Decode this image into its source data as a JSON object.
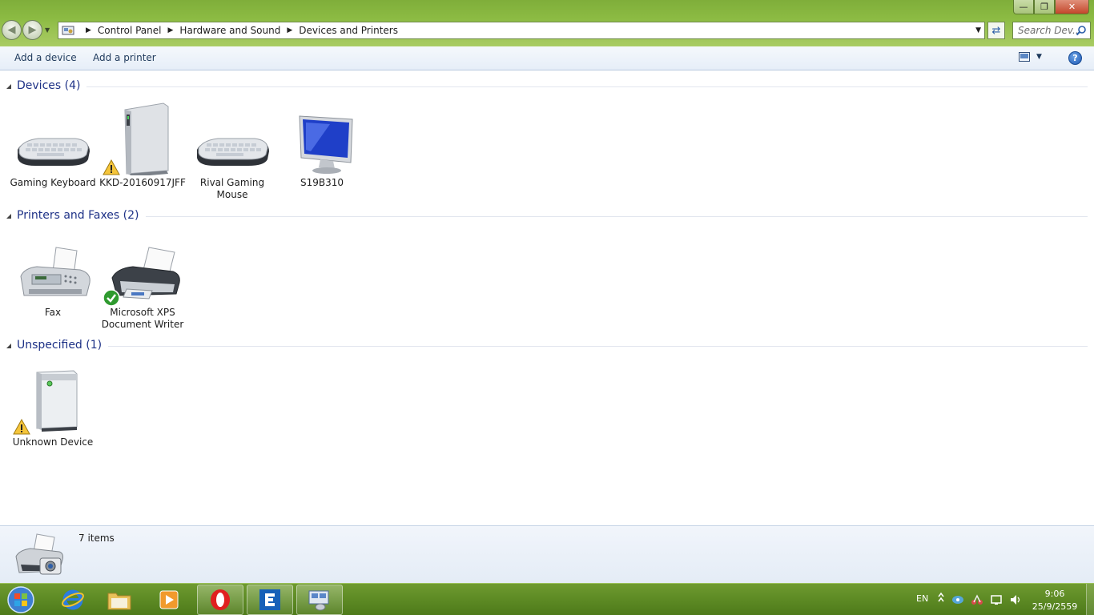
{
  "window": {
    "address": {
      "breadcrumbs": [
        "Control Panel",
        "Hardware and Sound",
        "Devices and Printers"
      ]
    },
    "search": {
      "placeholder": "Search Dev..."
    }
  },
  "commands": {
    "add_device": "Add a device",
    "add_printer": "Add a printer"
  },
  "groups": [
    {
      "title": "Devices (4)",
      "items": [
        {
          "label": "Gaming Keyboard",
          "icon": "keyboard-icon",
          "warning": false
        },
        {
          "label": "KKD-20160917JFF",
          "icon": "computer-tower-icon",
          "warning": true
        },
        {
          "label": "Rival Gaming Mouse",
          "icon": "keyboard-icon",
          "warning": false
        },
        {
          "label": "S19B310",
          "icon": "monitor-icon",
          "warning": false
        }
      ]
    },
    {
      "title": "Printers and Faxes (2)",
      "items": [
        {
          "label": "Fax",
          "icon": "fax-icon",
          "default": false
        },
        {
          "label": "Microsoft XPS Document Writer",
          "icon": "printer-icon",
          "default": true
        }
      ]
    },
    {
      "title": "Unspecified (1)",
      "items": [
        {
          "label": "Unknown Device",
          "icon": "unknown-device-icon",
          "warning": true
        }
      ]
    }
  ],
  "details": {
    "count": "7 items"
  },
  "taskbar": {
    "language": "EN",
    "time": "9:06",
    "date": "25/9/2559"
  },
  "colors": {
    "accent_group_title": "#1e3287",
    "taskbar_green": "#5d8a24"
  }
}
